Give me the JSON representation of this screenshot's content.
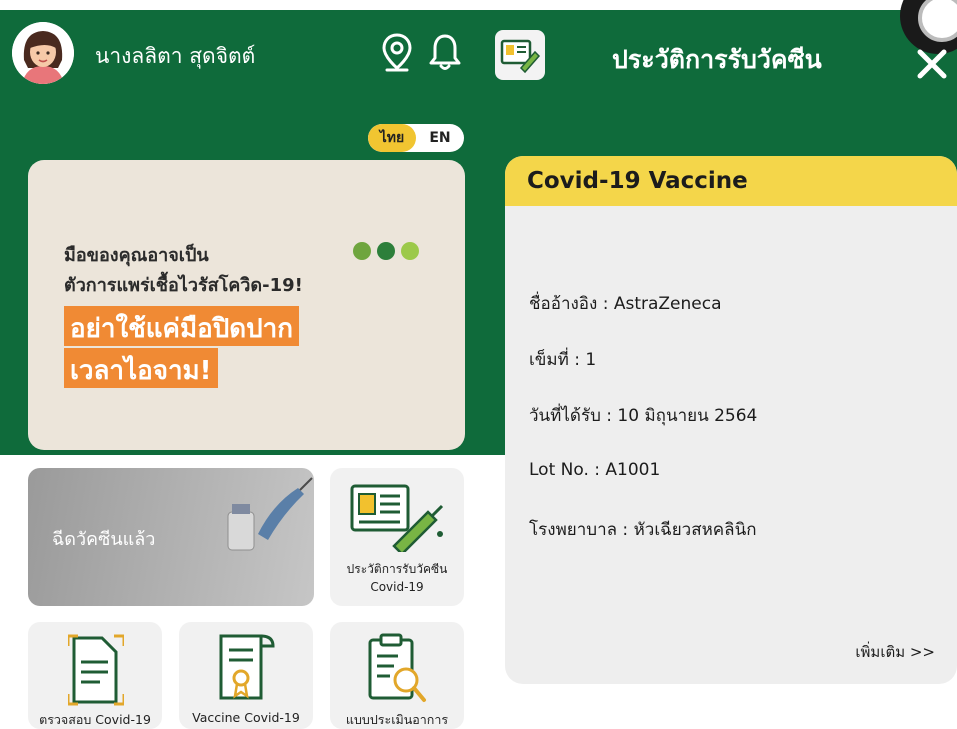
{
  "user": {
    "name": "นางลลิตา สุดจิตต์"
  },
  "language_toggle": {
    "thai": "ไทย",
    "english": "EN"
  },
  "banner": {
    "line1": "มือของคุณอาจเป็น",
    "line2": "ตัวการแพร่เชื้อไวรัสโควิด-19!",
    "highlight1": "อย่าใช้แค่มือปิดปาก",
    "highlight2": "เวลาไอจาม!"
  },
  "menu": {
    "vaccinated": "ฉีดวัคซีนแล้ว",
    "history_line1": "ประวัติการรับวัคซีน",
    "history_line2": "Covid-19",
    "check_covid": "ตรวจสอบ Covid-19",
    "vaccine_covid": "Vaccine Covid-19",
    "assessment": "แบบประเมินอาการ"
  },
  "vaccine_panel": {
    "title": "ประวัติการรับวัคซีน",
    "card_title": "Covid-19 Vaccine",
    "brand": "ชื่ออ้างอิง : AstraZeneca",
    "dose": "เข็มที่ : 1",
    "date": "วันที่ได้รับ : 10 มิถุนายน 2564",
    "lot": "Lot No. : A1001",
    "hospital": "โรงพยาบาล : หัวเฉียวสหคลินิก",
    "more": "เพิ่มเติม >>"
  },
  "colors": {
    "green": "#0f6b3b",
    "yellow": "#f4d64a",
    "orange": "#f08a34"
  }
}
